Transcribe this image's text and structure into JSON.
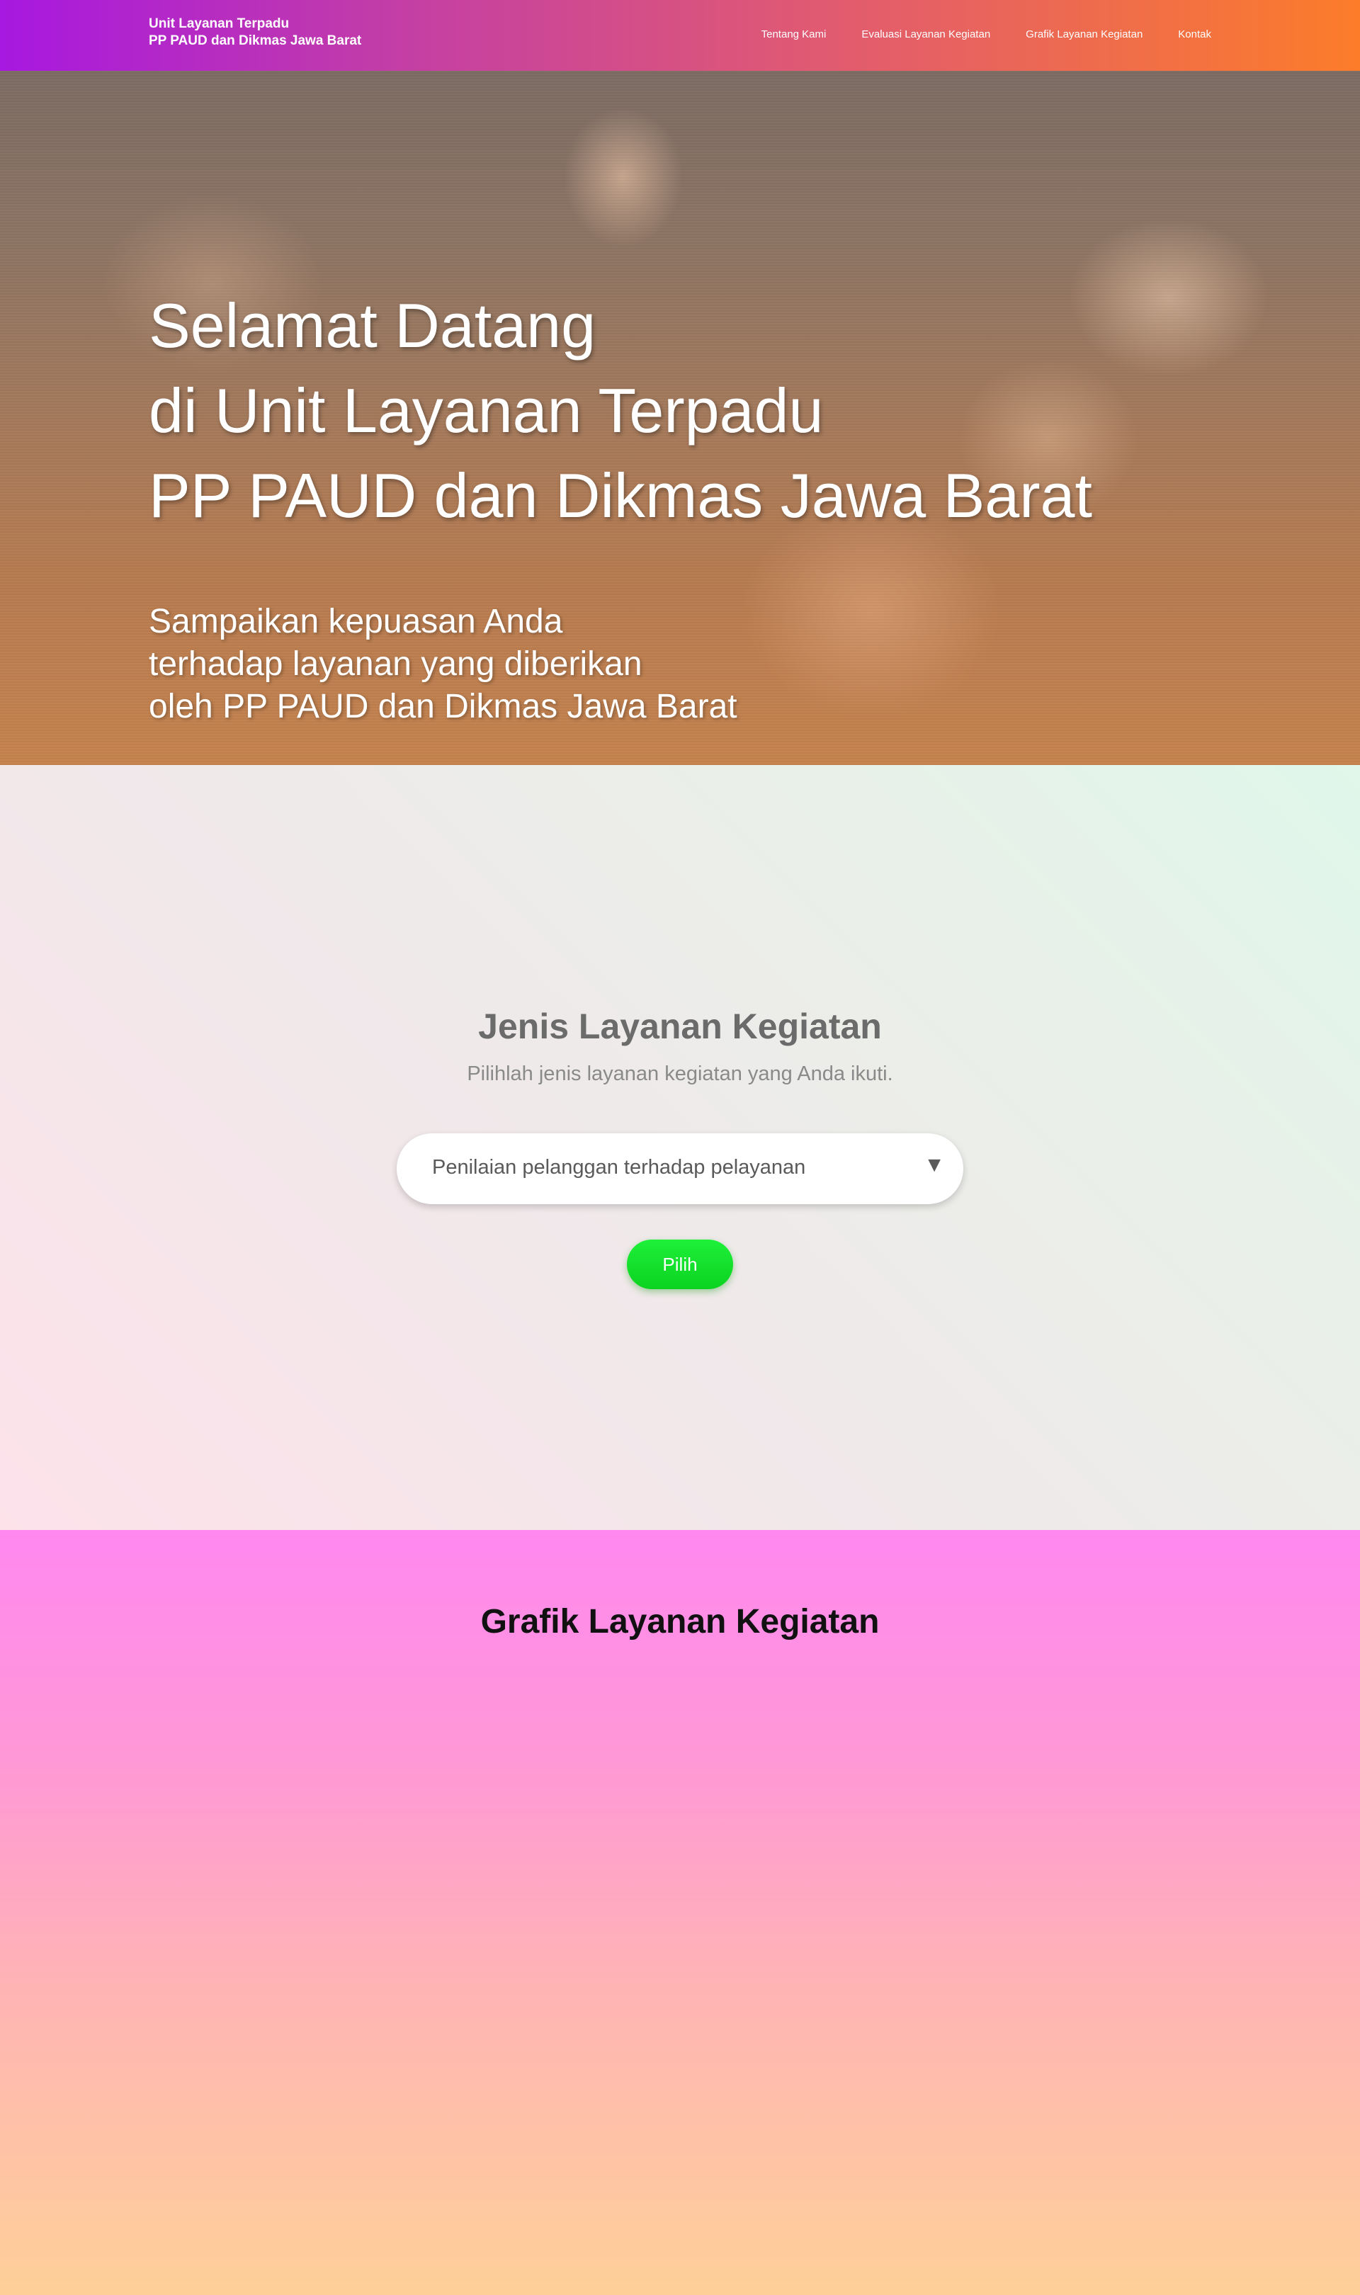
{
  "navbar": {
    "brand_line1": "Unit Layanan Terpadu",
    "brand_line2": "PP PAUD dan Dikmas Jawa Barat",
    "links": [
      {
        "label": "Tentang Kami"
      },
      {
        "label": "Evaluasi Layanan Kegiatan"
      },
      {
        "label": "Grafik Layanan Kegiatan"
      },
      {
        "label": "Kontak"
      }
    ]
  },
  "hero": {
    "title_lines": [
      "Selamat Datang",
      "di Unit Layanan Terpadu",
      "PP PAUD dan Dikmas Jawa Barat"
    ],
    "subtitle_lines": [
      "Sampaikan kepuasan Anda",
      "terhadap layanan yang diberikan",
      "oleh PP PAUD dan Dikmas Jawa Barat"
    ]
  },
  "service": {
    "title": "Jenis Layanan Kegiatan",
    "subtitle": "Pilihlah jenis layanan kegiatan yang  Anda ikuti.",
    "select_value": "Penilaian pelanggan terhadap pelayanan",
    "select_arrow": "▼",
    "button_label": "Pilih"
  },
  "grafik": {
    "title": "Grafik Layanan Kegiatan"
  },
  "colors": {
    "nav_gradient_start": "#a718e0",
    "nav_gradient_end": "#fc7c2a",
    "button_green": "#12e02a",
    "grafik_top": "#ff88f0",
    "grafik_bottom": "#fed098"
  }
}
